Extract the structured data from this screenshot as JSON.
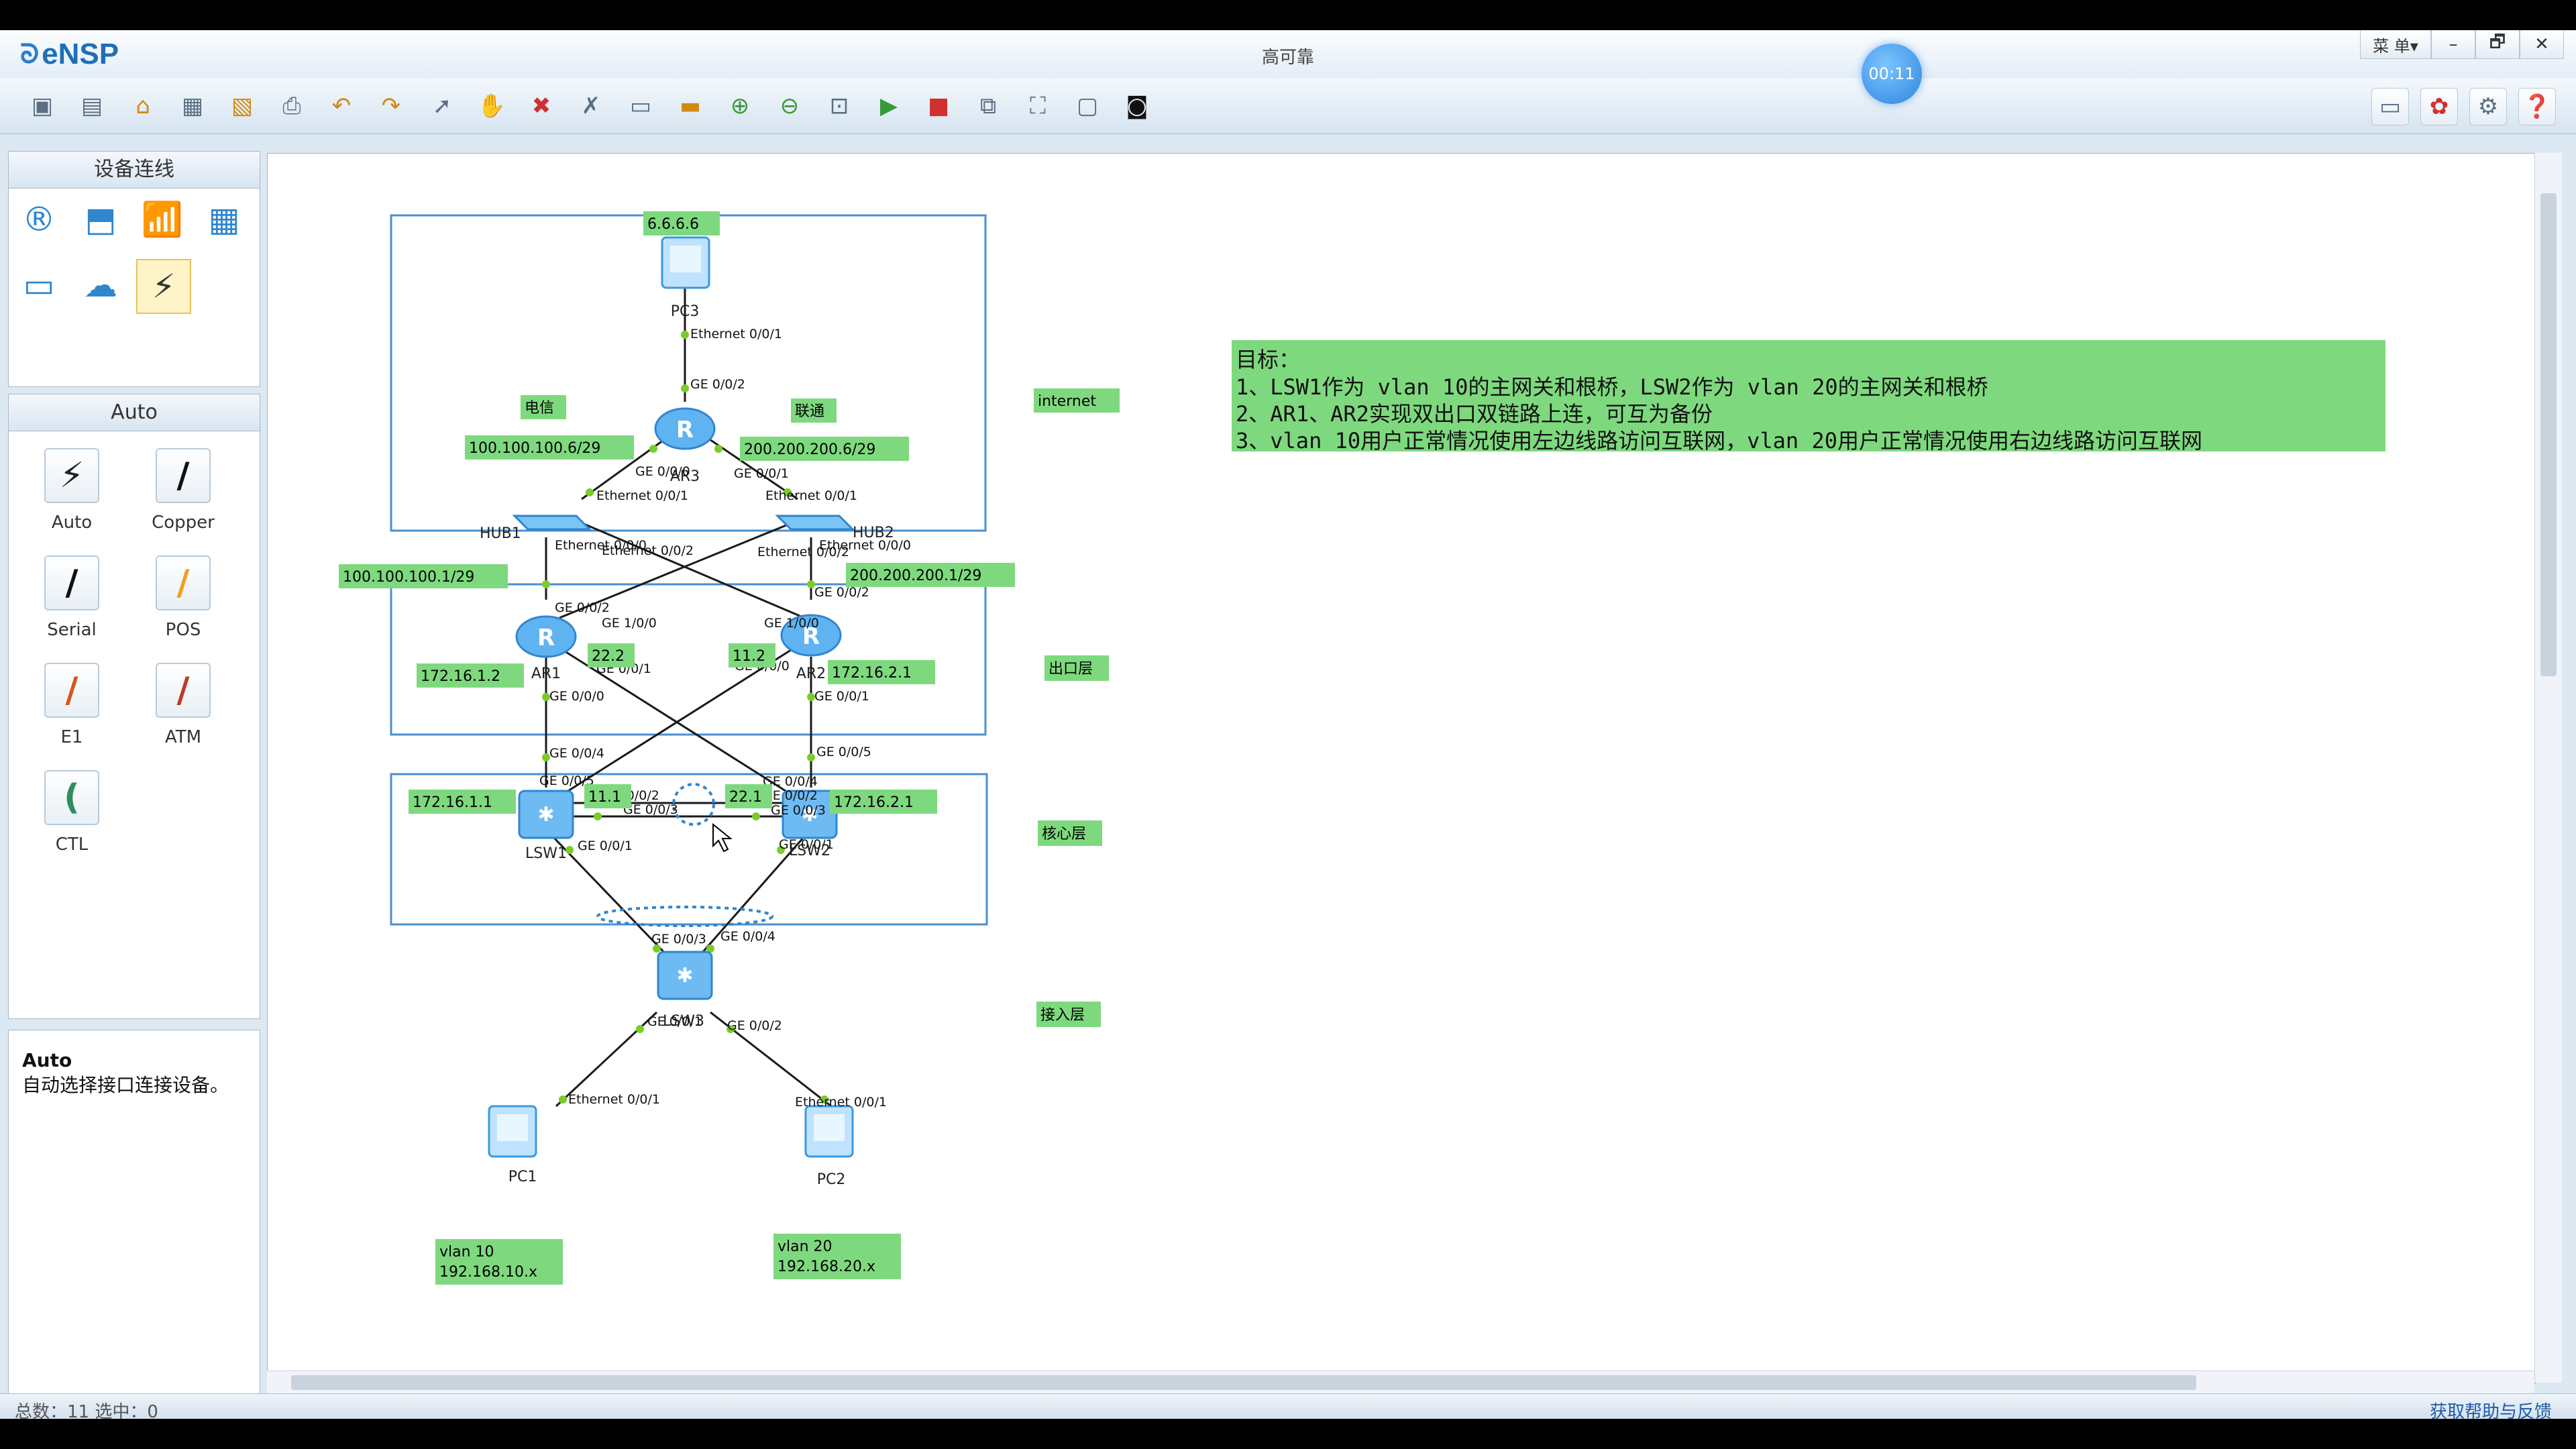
{
  "app": {
    "logo": "eNSP",
    "window_title": "高可靠",
    "timer": "00:11",
    "menu_label": "菜 单▾"
  },
  "window_buttons": [
    "–",
    "🗗",
    "✕"
  ],
  "toolbar": {
    "left_icons": [
      "new-topology-icon",
      "new-lab-icon",
      "open-icon",
      "save-icon",
      "save-as-icon",
      "print-icon",
      "undo-icon",
      "redo-icon",
      "select-icon",
      "pan-icon",
      "delete-icon",
      "delete-link-icon",
      "text-icon",
      "palette-icon",
      "zoom-in-icon",
      "zoom-out-icon",
      "fit-icon",
      "start-icon",
      "stop-icon",
      "capture-icon",
      "topology-icon",
      "layout-icon",
      "cli-icon"
    ],
    "right_icons": [
      "chat-icon",
      "huawei-icon",
      "settings-icon",
      "help-icon"
    ]
  },
  "sidebar": {
    "device_panel_title": "设备连线",
    "device_icons": [
      "router-icon",
      "switch-icon",
      "wireless-icon",
      "firewall-icon",
      "pc-icon",
      "cloud-icon",
      "auto-cable-icon"
    ],
    "cable_panel_title": "Auto",
    "cables": [
      {
        "label": "Auto",
        "color": "#222222",
        "glyph": "⚡"
      },
      {
        "label": "Copper",
        "color": "#111111",
        "glyph": "/"
      },
      {
        "label": "Serial",
        "color": "#111111",
        "glyph": "/"
      },
      {
        "label": "POS",
        "color": "#f0a020",
        "glyph": "/"
      },
      {
        "label": "E1",
        "color": "#d9541a",
        "glyph": "/"
      },
      {
        "label": "ATM",
        "color": "#c0392b",
        "glyph": "/"
      },
      {
        "label": "CTL",
        "color": "#2f8f5a",
        "glyph": "("
      }
    ],
    "info_title": "Auto",
    "info_desc": "自动选择接口连接设备。"
  },
  "topology": {
    "devices": {
      "pc3": "PC3",
      "ar3": "AR3",
      "hub1": "HUB1",
      "hub2": "HUB2",
      "ar1": "AR1",
      "ar2": "AR2",
      "lsw1": "LSW1",
      "lsw2": "LSW2",
      "lsw3": "LSW3",
      "pc1": "PC1",
      "pc2": "PC2"
    },
    "green_labels": {
      "pc3_ip": "6.6.6.6",
      "telecom": "电信",
      "unicom": "联通",
      "ar3_left_ip": "100.100.100.6/29",
      "ar3_right_ip": "200.200.200.6/29",
      "ar1_up_ip": "100.100.100.1/29",
      "ar2_up_ip": "200.200.200.1/29",
      "ar1_down_ip": "172.16.1.2",
      "ar1_cross": "22.2",
      "ar2_cross": "11.2",
      "ar2_down_ip": "172.16.2.1",
      "lsw1_ip": "172.16.1.1",
      "lsw1_cross": "11.1",
      "lsw2_cross": "22.1",
      "lsw2_ip": "172.16.2.1",
      "internet": "internet",
      "egress_layer": "出口层",
      "core_layer": "核心层",
      "access_layer": "接入层",
      "vlan10": "vlan 10",
      "vlan10_net": "192.168.10.x",
      "vlan20": "vlan 20",
      "vlan20_net": "192.168.20.x"
    },
    "ports": {
      "pc3_eth": "Ethernet 0/0/1",
      "ar3_ge2": "GE 0/0/2",
      "ar3_ge0": "GE 0/0/0",
      "ar3_ge1": "GE 0/0/1",
      "hub1_eth1": "Ethernet 0/0/1",
      "hub2_eth1": "Ethernet 0/0/1",
      "hub1_eth0": "Ethernet 0/0/0",
      "hub1_eth2": "Ethernet 0/0/2",
      "hub2_eth2": "Ethernet 0/0/2",
      "hub2_eth0": "Ethernet 0/0/0",
      "ar1_ge2": "GE 0/0/2",
      "ar1_ge10": "GE 1/0/0",
      "ar1_ge1": "GE 0/0/1",
      "ar1_ge0": "GE 0/0/0",
      "ar2_ge2": "GE 0/0/2",
      "ar2_ge10": "GE 1/0/0",
      "ar2_ge0": "GE 0/0/0",
      "ar2_ge1": "GE 0/0/1",
      "lsw1_ge4": "GE 0/0/4",
      "lsw1_ge5": "GE 0/0/5",
      "lsw1_ge2": "GE 0/0/2",
      "lsw1_ge3": "GE 0/0/3",
      "lsw1_ge1": "GE 0/0/1",
      "lsw2_ge5": "GE 0/0/5",
      "lsw2_ge4": "GE 0/0/4",
      "lsw2_ge2": "GE 0/0/2",
      "lsw2_ge3": "GE 0/0/3",
      "lsw2_ge1": "GE 0/0/1",
      "lsw3_ge3": "GE 0/0/3",
      "lsw3_ge4": "GE 0/0/4",
      "lsw3_ge1": "GE 0/0/1",
      "lsw3_ge2": "GE 0/0/2",
      "pc1_eth": "Ethernet 0/0/1",
      "pc2_eth": "Ethernet 0/0/1"
    },
    "goals": [
      "目标：",
      "1、LSW1作为 vlan 10的主网关和根桥，LSW2作为 vlan 20的主网关和根桥",
      "2、AR1、AR2实现双出口双链路上连，可互为备份",
      "3、vlan 10用户正常情况使用左边线路访问互联网，vlan 20用户正常情况使用右边线路访问互联网"
    ]
  },
  "status": {
    "left": "总数：11  选中：0",
    "right": "获取帮助与反馈"
  },
  "colors": {
    "label_bg": "#7ed97e",
    "device": "#3a9ae0",
    "link": "#1a1a1a",
    "port_dot": "#7acc2a"
  }
}
